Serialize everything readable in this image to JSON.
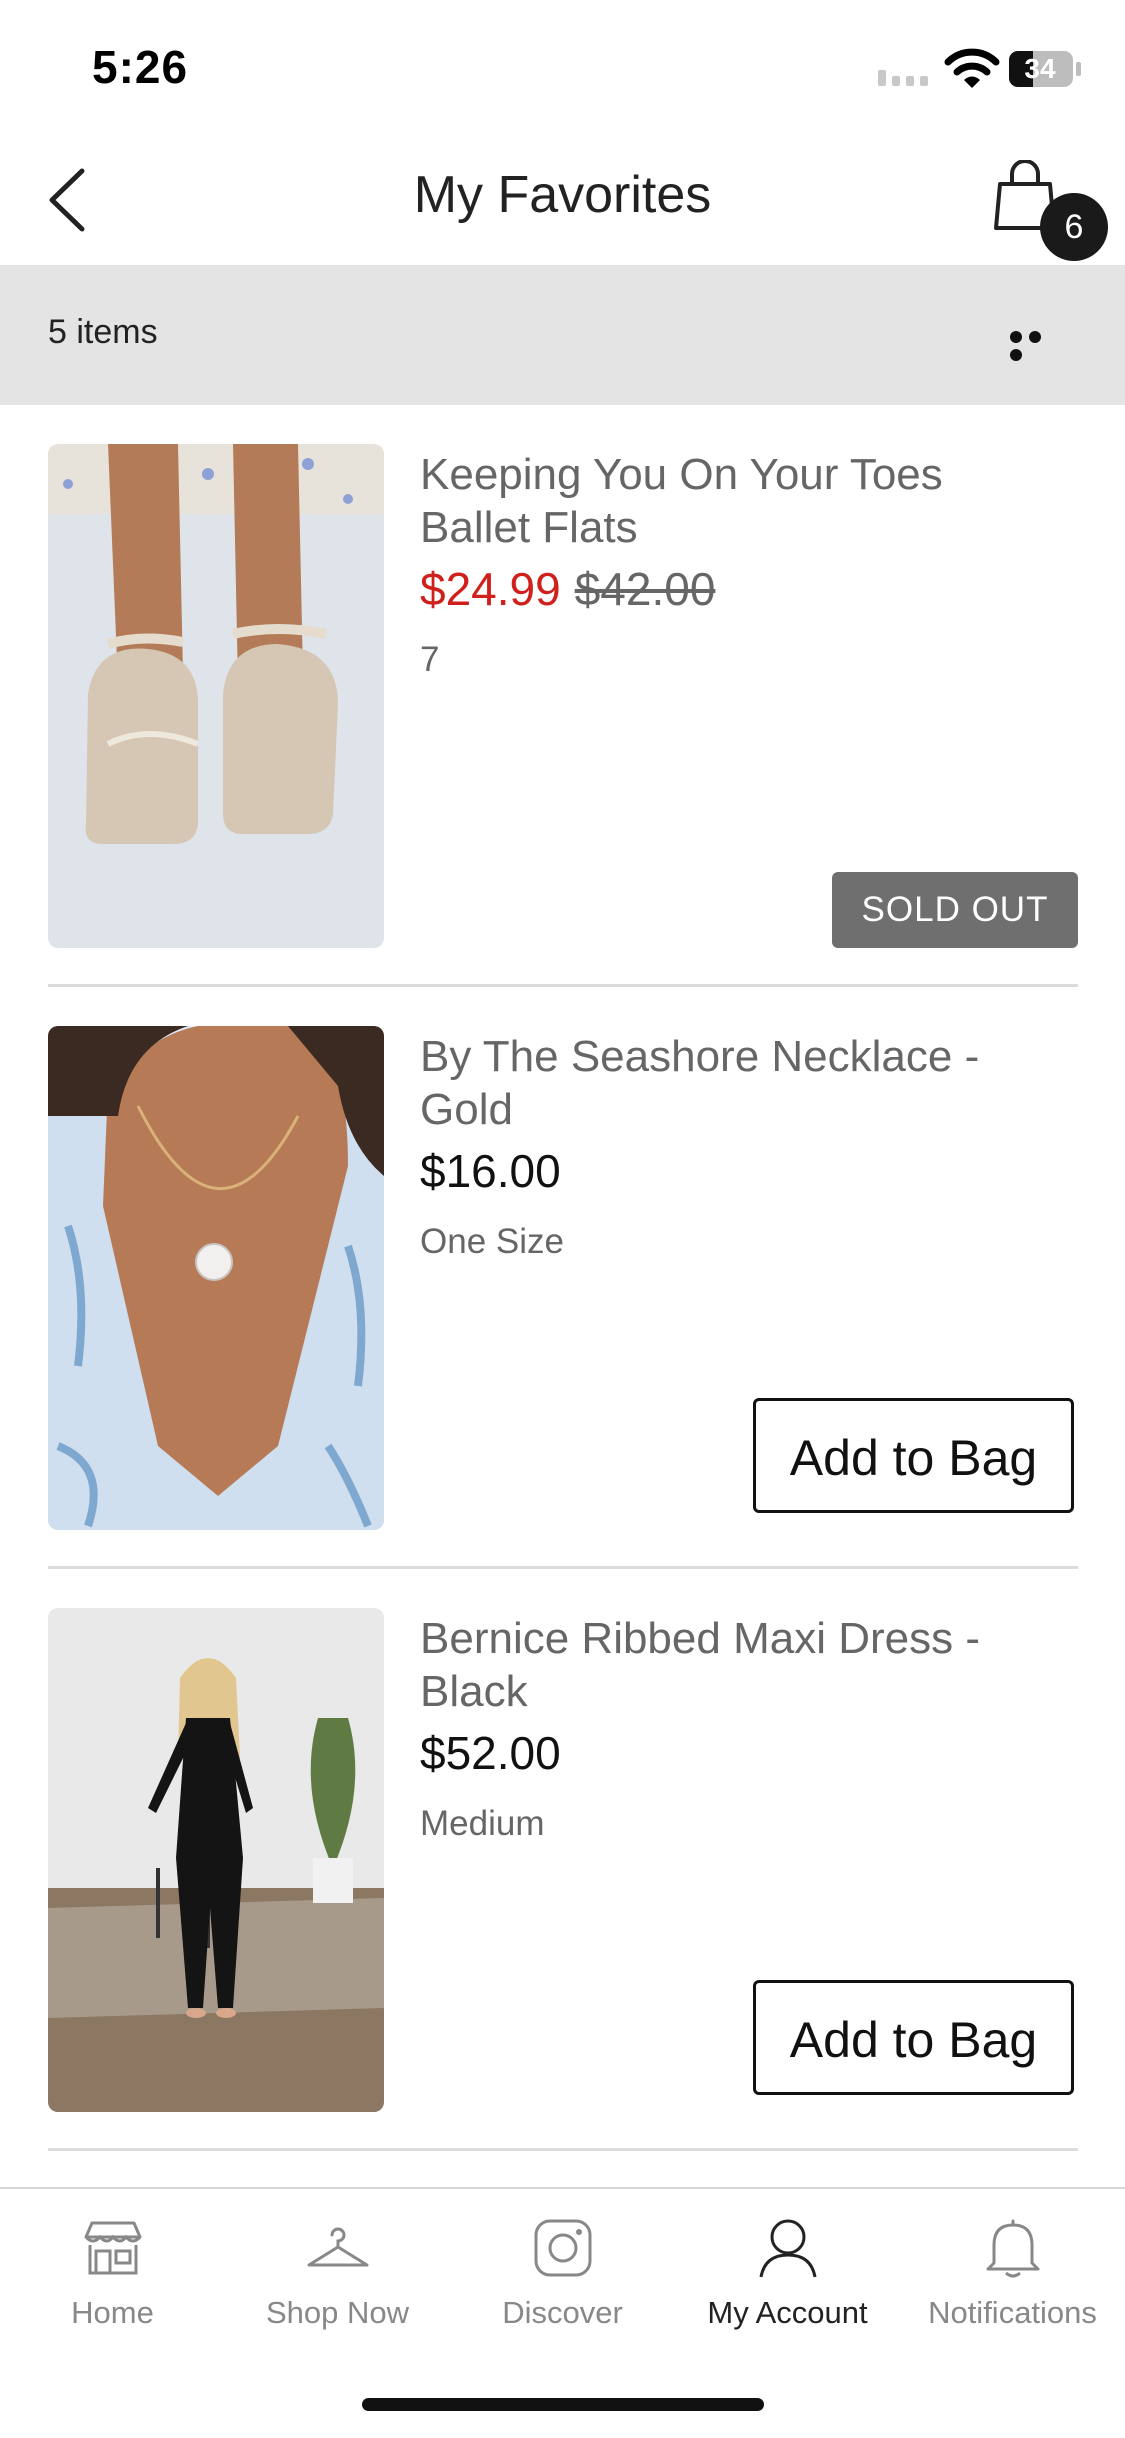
{
  "status_bar": {
    "time": "5:26",
    "battery": "34"
  },
  "header": {
    "title": "My Favorites",
    "bag_count": "6"
  },
  "items_bar": {
    "count_label": "5 items"
  },
  "products": [
    {
      "name": "Keeping You On Your Toes Ballet Flats",
      "sale_price": "$24.99",
      "original_price": "$42.00",
      "size": "7",
      "status": "SOLD OUT"
    },
    {
      "name": "By The Seashore Necklace - Gold",
      "price": "$16.00",
      "size": "One Size",
      "action": "Add to Bag"
    },
    {
      "name": "Bernice Ribbed Maxi Dress - Black",
      "price": "$52.00",
      "size": "Medium",
      "action": "Add to Bag"
    }
  ],
  "tab_bar": {
    "tabs": [
      {
        "label": "Home",
        "icon": "storefront-icon"
      },
      {
        "label": "Shop Now",
        "icon": "hanger-icon"
      },
      {
        "label": "Discover",
        "icon": "instagram-icon"
      },
      {
        "label": "My Account",
        "icon": "person-icon"
      },
      {
        "label": "Notifications",
        "icon": "bell-icon"
      }
    ],
    "active": "My Account"
  },
  "colors": {
    "sale_price": "#d0201c",
    "sold_out_bg": "#6f6f6f",
    "items_bar_bg": "#e4e4e4"
  }
}
